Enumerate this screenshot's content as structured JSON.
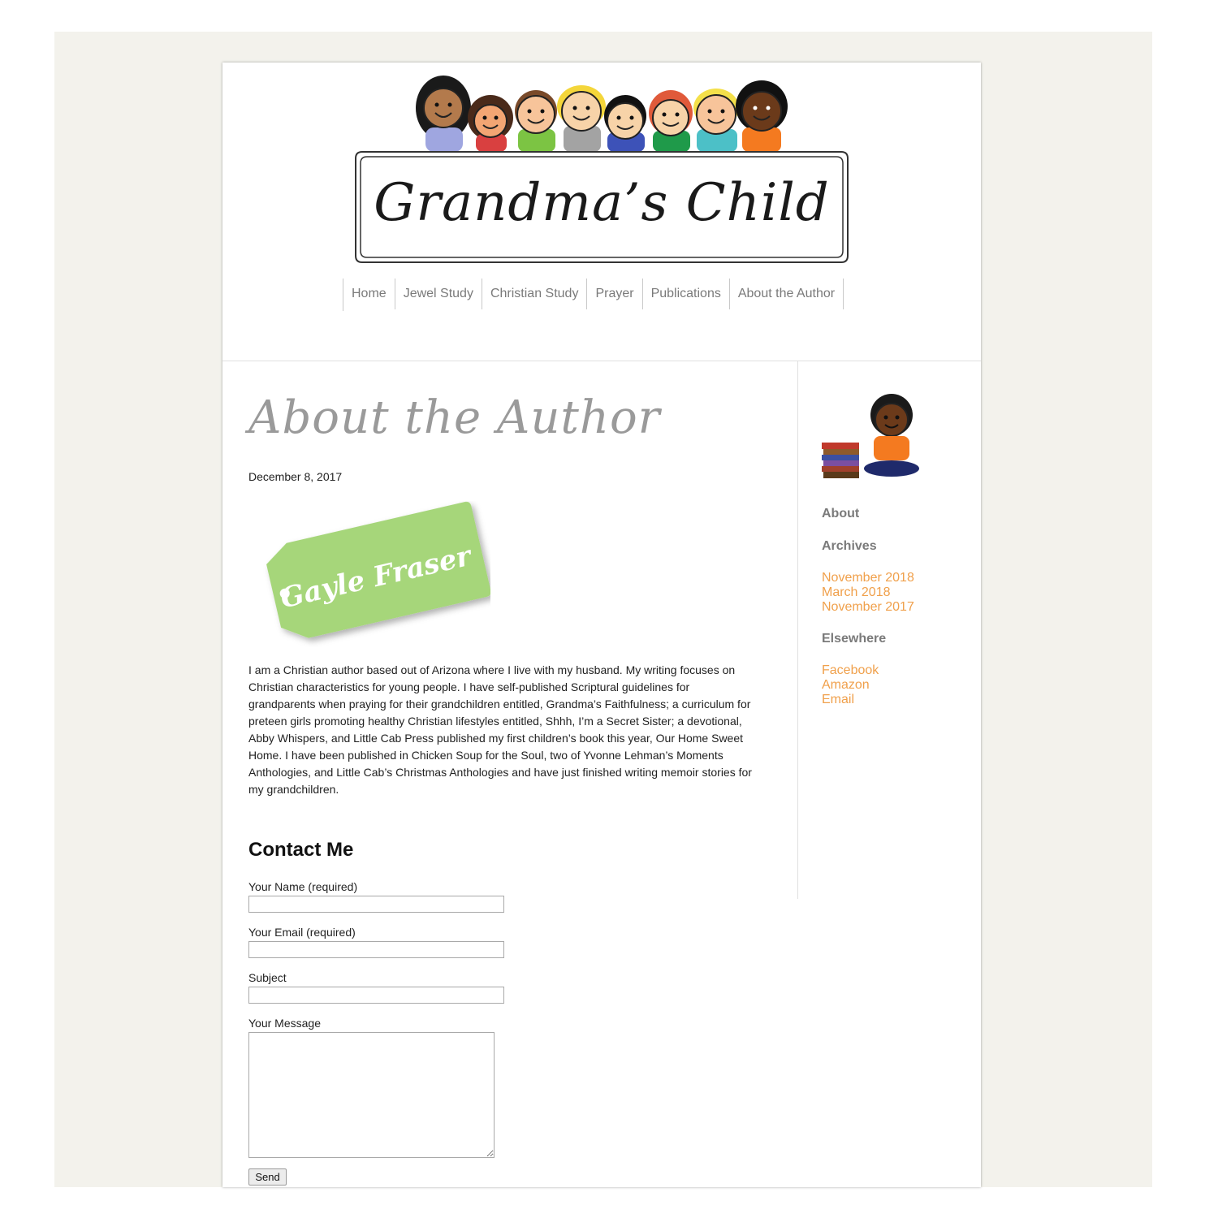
{
  "site": {
    "title": "Grandma’s Child"
  },
  "nav": {
    "items": [
      {
        "label": "Home"
      },
      {
        "label": "Jewel Study"
      },
      {
        "label": "Christian Study"
      },
      {
        "label": "Prayer"
      },
      {
        "label": "Publications"
      },
      {
        "label": "About the Author"
      }
    ]
  },
  "post": {
    "title": "About the Author",
    "date": "December 8, 2017",
    "tag_text": "Gayle Fraser",
    "bio": "I am a Christian author based out of Arizona where I live with my husband.  My writing focuses on Christian characteristics for young people.  I have self-published Scriptural guidelines for grandparents when praying for their grandchildren entitled, Grandma’s Faithfulness; a curriculum for preteen girls promoting healthy Christian lifestyles entitled, Shhh, I’m a Secret Sister; a devotional, Abby Whispers, and Little Cab Press published my first children’s book this year, Our Home Sweet Home.  I have been published in Chicken Soup for the Soul, two of Yvonne Lehman’s Moments Anthologies, and Little Cab’s Christmas Anthologies and have just finished writing memoir stories for my grandchildren."
  },
  "contact": {
    "heading": "Contact Me",
    "name_label": "Your Name (required)",
    "email_label": "Your Email (required)",
    "subject_label": "Subject",
    "message_label": "Your Message",
    "send_label": "Send"
  },
  "sidebar": {
    "about_heading": "About",
    "archives_heading": "Archives",
    "archives": [
      {
        "label": "November 2018"
      },
      {
        "label": "March 2018"
      },
      {
        "label": "November 2017"
      }
    ],
    "elsewhere_heading": "Elsewhere",
    "elsewhere": [
      {
        "label": "Facebook"
      },
      {
        "label": "Amazon"
      },
      {
        "label": "Email"
      }
    ]
  },
  "colors": {
    "page_background": "#f3f2ec",
    "link": "#f0a04b",
    "heading_gray": "#7a7a7a",
    "tag_green": "#a6d67a"
  },
  "icons": {
    "header_art": "children-row-illustration",
    "sidebar_art": "boy-reading-books-illustration"
  }
}
